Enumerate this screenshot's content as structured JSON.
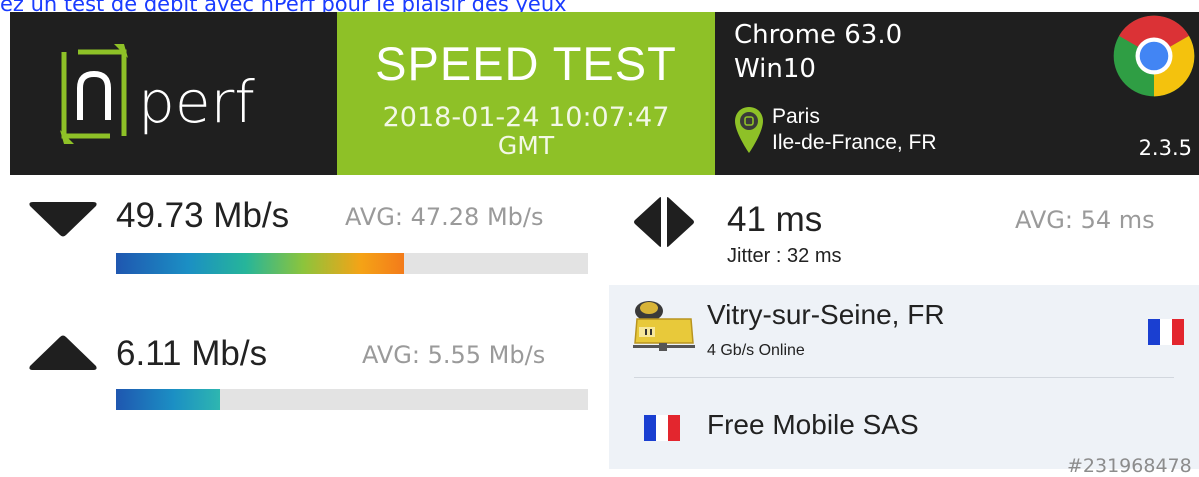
{
  "top_link": "ez un test de débit avec nPerf pour le plaisir des yeux",
  "header": {
    "logo_text": "perf",
    "title": "SPEED TEST",
    "date": "2018-01-24 10:07:47",
    "timezone": "GMT",
    "browser": "Chrome 63.0",
    "os": "Win10",
    "city": "Paris",
    "region": "Ile-de-France, FR",
    "version": "2.3.5"
  },
  "download": {
    "value": "49.73 Mb/s",
    "avg": "AVG: 47.28 Mb/s",
    "fill_fraction": 0.61
  },
  "upload": {
    "value": "6.11 Mb/s",
    "avg": "AVG: 5.55 Mb/s",
    "fill_fraction": 0.22
  },
  "latency": {
    "value": "41 ms",
    "jitter": "Jitter : 32 ms",
    "avg": "AVG: 54 ms"
  },
  "server": {
    "name": "Vitry-sur-Seine, FR",
    "status": "4 Gb/s Online",
    "isp": "Free Mobile SAS",
    "test_id": "#231968478"
  },
  "colors": {
    "header_bg": "#1f1f1f",
    "accent_green": "#8ec127",
    "flag_blue": "#1a3fd1",
    "flag_red": "#e3262e"
  },
  "icons": {
    "download": "triangle-down-icon",
    "upload": "triangle-up-icon",
    "latency": "left-right-arrows-icon",
    "location": "map-pin-icon",
    "browser": "chrome-logo-icon",
    "server": "server-icon",
    "flag": "french-flag-icon"
  }
}
